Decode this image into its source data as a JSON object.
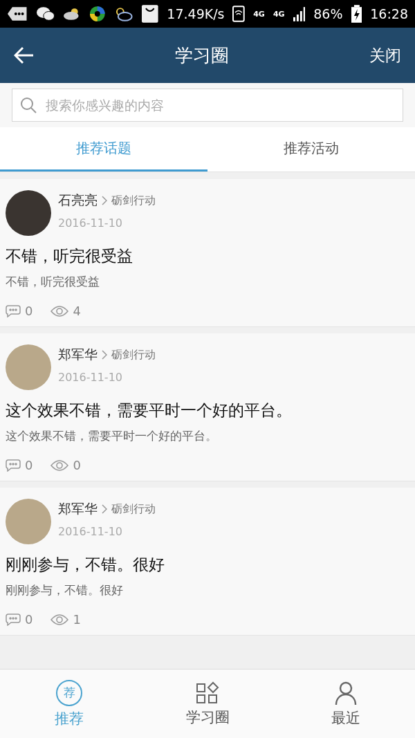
{
  "status_bar": {
    "speed": "17.49K/s",
    "network_1": "4G",
    "network_2": "4G",
    "battery": "86%",
    "time": "16:28"
  },
  "header": {
    "title": "学习圈",
    "close": "关闭"
  },
  "search": {
    "placeholder": "搜索你感兴趣的内容"
  },
  "tabs": [
    {
      "label": "推荐话题",
      "selected": true
    },
    {
      "label": "推荐活动",
      "selected": false
    }
  ],
  "posts": [
    {
      "author": "石亮亮",
      "group": "砺剑行动",
      "date": "2016-11-10",
      "title": "不错，听完很受益",
      "body": "不错，听完很受益",
      "comments": "0",
      "views": "4"
    },
    {
      "author": "郑军华",
      "group": "砺剑行动",
      "date": "2016-11-10",
      "title": "这个效果不错，需要平时一个好的平台。",
      "body": "这个效果不错，需要平时一个好的平台。",
      "comments": "0",
      "views": "0"
    },
    {
      "author": "郑军华",
      "group": "砺剑行动",
      "date": "2016-11-10",
      "title": "刚刚参与，不错。很好",
      "body": "刚刚参与，不错。很好",
      "comments": "0",
      "views": "1"
    }
  ],
  "bottom_nav": [
    {
      "kind": "recommend",
      "label": "推荐",
      "icon_text": "荐",
      "selected": true
    },
    {
      "kind": "circle",
      "label": "学习圈",
      "selected": false
    },
    {
      "kind": "recent",
      "label": "最近",
      "selected": false
    }
  ]
}
